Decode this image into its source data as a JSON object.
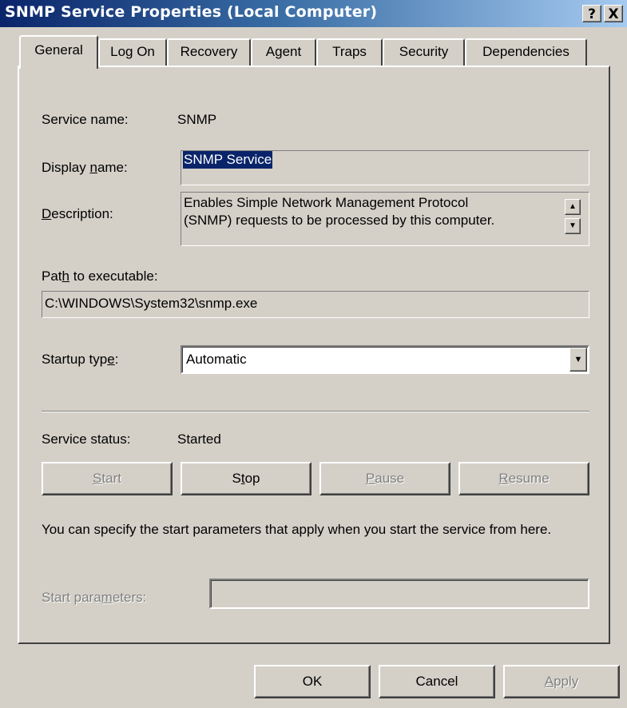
{
  "window": {
    "title": "SNMP Service Properties (Local Computer)",
    "help_button": "?",
    "close_button": "X"
  },
  "tabs": [
    {
      "label": "General",
      "active": true
    },
    {
      "label": "Log On"
    },
    {
      "label": "Recovery"
    },
    {
      "label": "Agent"
    },
    {
      "label": "Traps"
    },
    {
      "label": "Security"
    },
    {
      "label": "Dependencies"
    }
  ],
  "general": {
    "service_name_label": "Service name:",
    "service_name": "SNMP",
    "display_name_label_pre": "Display ",
    "display_name_label_u": "n",
    "display_name_label_post": "ame:",
    "display_name": "SNMP Service",
    "description_label_u": "D",
    "description_label_post": "escription:",
    "description_line1": "Enables Simple Network Management Protocol",
    "description_line2": "(SNMP) requests to be processed by this computer.",
    "path_label_pre": "Pat",
    "path_label_u": "h",
    "path_label_post": " to executable:",
    "path": "C:\\WINDOWS\\System32\\snmp.exe",
    "startup_label_pre": "Startup typ",
    "startup_label_u": "e",
    "startup_label_post": ":",
    "startup_type": "Automatic",
    "status_label": "Service status:",
    "status": "Started",
    "buttons": {
      "start_u": "S",
      "start_post": "tart",
      "stop_pre": "S",
      "stop_u": "t",
      "stop_post": "op",
      "pause_u": "P",
      "pause_post": "ause",
      "resume_u": "R",
      "resume_post": "esume"
    },
    "info_text": "You can specify the start parameters that apply when you start the service from here.",
    "start_params_label_pre": "Start para",
    "start_params_label_u": "m",
    "start_params_label_post": "eters:",
    "start_params_value": ""
  },
  "footer": {
    "ok": "OK",
    "cancel": "Cancel",
    "apply_u": "A",
    "apply_post": "pply"
  },
  "colors": {
    "face": "#d4d0c8",
    "title_start": "#0a246a",
    "title_end": "#a6caf0",
    "selection": "#0a246a"
  },
  "icons": {
    "scroll_up": "▲",
    "scroll_down": "▼",
    "dropdown": "▼"
  }
}
